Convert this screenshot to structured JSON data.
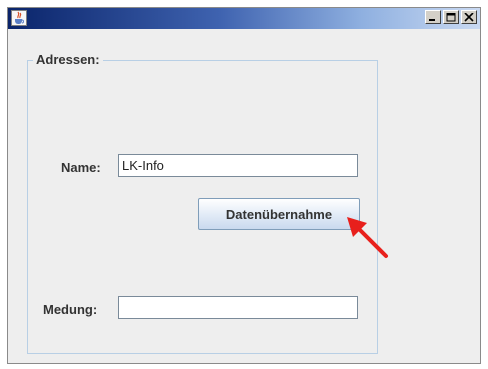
{
  "window": {
    "title": ""
  },
  "panel": {
    "title": "Adressen:"
  },
  "form": {
    "name_label": "Name:",
    "name_value": "LK-Info",
    "button_label": "Datenübernahme",
    "medung_label": "Medung:",
    "medung_value": ""
  },
  "colors": {
    "titlebar_start": "#0a246a",
    "arrow": "#e8201c"
  },
  "icons": [
    "java-cup-icon",
    "minimize-icon",
    "maximize-icon",
    "close-icon",
    "red-arrow-annotation"
  ]
}
